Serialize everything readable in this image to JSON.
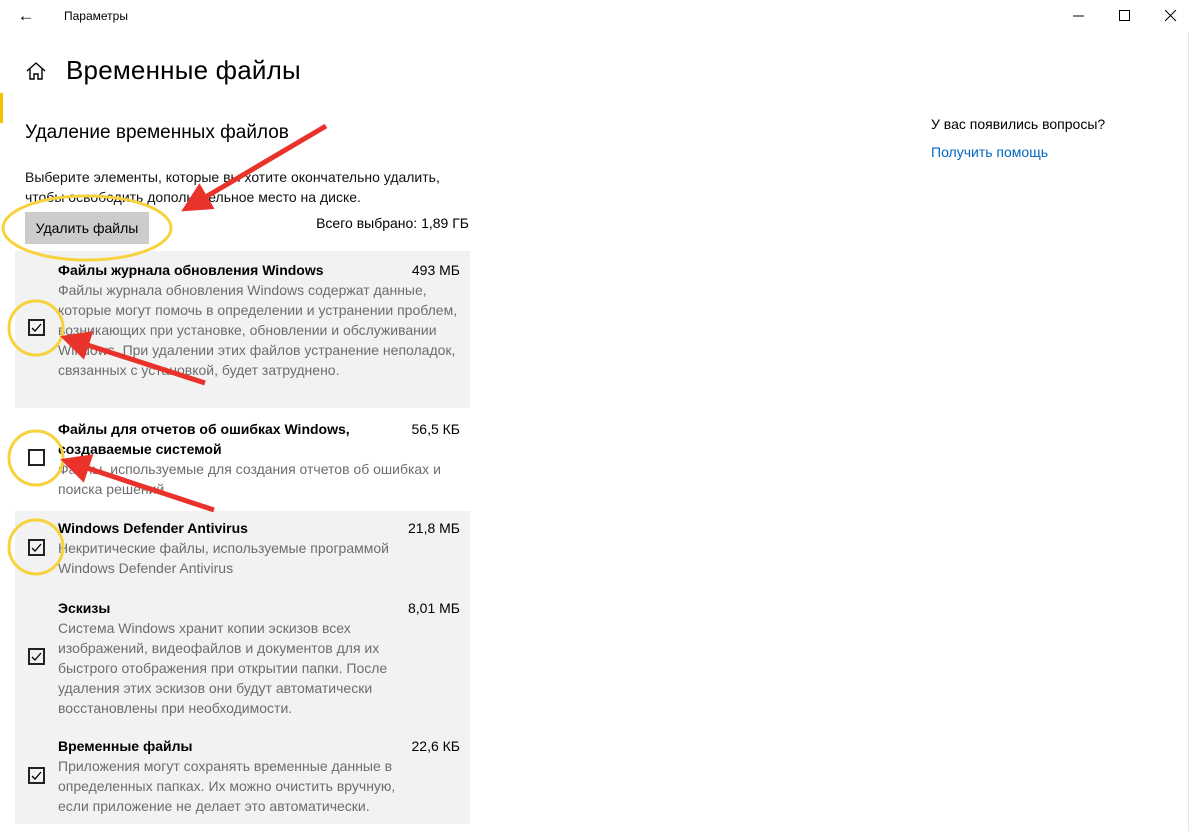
{
  "window": {
    "title": "Параметры"
  },
  "page": {
    "title": "Временные файлы"
  },
  "section": {
    "title": "Удаление временных файлов",
    "description": "Выберите элементы, которые вы хотите окончательно удалить, чтобы освободить дополнительное место на диске.",
    "delete_button": "Удалить файлы",
    "total_selected": "Всего выбрано: 1,89 ГБ"
  },
  "items": [
    {
      "name": "Файлы журнала обновления Windows",
      "size": "493 МБ",
      "checked": true,
      "description": "Файлы журнала обновления Windows содержат данные, которые могут помочь в определении и устранении проблем, возникающих при установке, обновлении и обслуживании Windows. При удалении этих файлов устранение неполадок, связанных с установкой, будет затруднено."
    },
    {
      "name": "Файлы для отчетов об ошибках Windows, создаваемые системой",
      "size": "56,5 КБ",
      "checked": false,
      "description": "Файлы, используемые для создания отчетов об ошибках и поиска решений."
    },
    {
      "name": "Windows Defender Antivirus",
      "size": "21,8 МБ",
      "checked": true,
      "description": "Некритические файлы, используемые программой Windows Defender Antivirus"
    },
    {
      "name": "Эскизы",
      "size": "8,01 МБ",
      "checked": true,
      "description": "Система Windows хранит копии эскизов всех изображений, видеофайлов и документов для их быстрого отображения при открытии папки. После удаления этих эскизов они будут автоматически восстановлены при необходимости."
    },
    {
      "name": "Временные файлы",
      "size": "22,6 КБ",
      "checked": true,
      "description": "Приложения могут сохранять временные данные в определенных папках. Их можно очистить вручную, если приложение не делает это автоматически."
    }
  ],
  "help": {
    "question": "У вас появились вопросы?",
    "link": "Получить помощь"
  },
  "annotation_colors": {
    "arrow": "#e8322a",
    "circle": "#f7d23c"
  },
  "icons": [
    "back-arrow-icon",
    "minimize-icon",
    "maximize-icon",
    "close-icon",
    "home-icon",
    "checkmark-icon"
  ]
}
